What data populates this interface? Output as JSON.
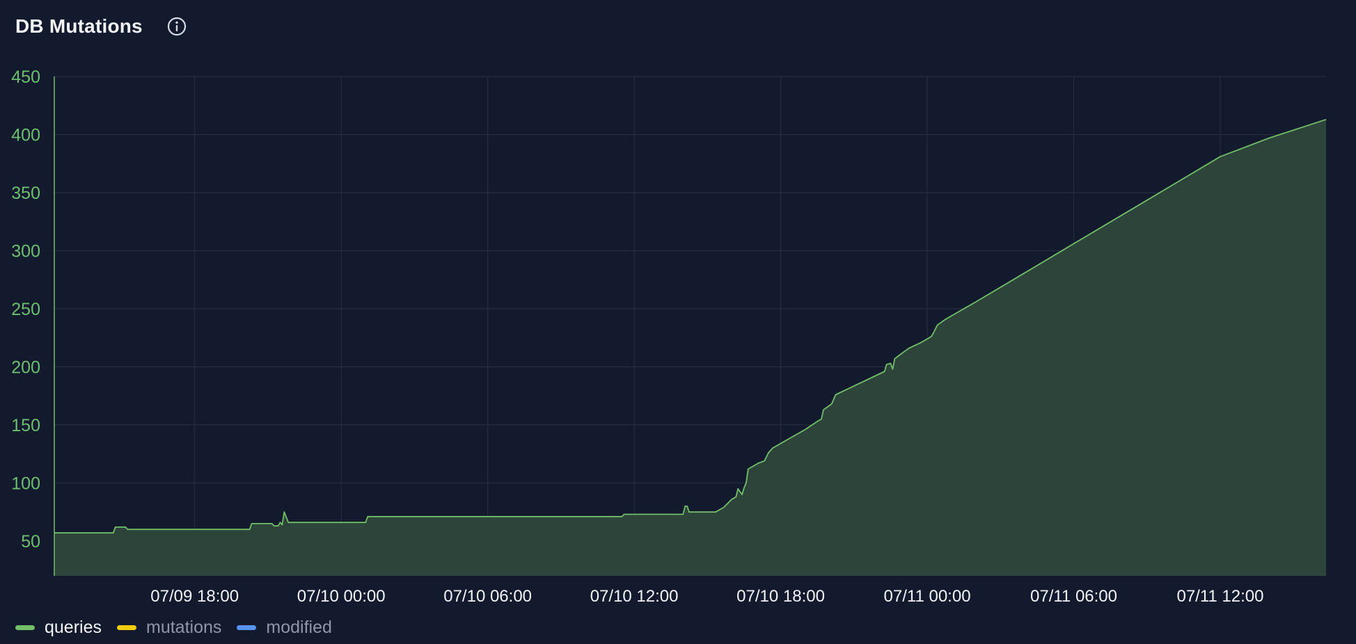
{
  "panel": {
    "title": "DB Mutations",
    "info_icon": "info-circle-icon"
  },
  "colors": {
    "background": "#131a2e",
    "grid": "#2a3146",
    "axis_text": "#6bbf6e",
    "x_tick_text": "#f2f4f8",
    "queries": "#73bf69",
    "queries_fill": "#2c4439",
    "mutations": "#f2cc0c",
    "modified": "#5794f2",
    "legend_active": "#f2f4f8",
    "legend_inactive": "#8e96a8"
  },
  "legend": [
    {
      "name": "queries",
      "color": "#73bf69",
      "active": true
    },
    {
      "name": "mutations",
      "color": "#f2cc0c",
      "active": false
    },
    {
      "name": "modified",
      "color": "#5794f2",
      "active": false
    }
  ],
  "chart_data": {
    "type": "area",
    "title": "DB Mutations",
    "xlabel": "",
    "ylabel": "",
    "x_unit": "hours",
    "xlim": [
      "07/09 12:15",
      "07/11 16:20"
    ],
    "ylim": [
      20,
      450
    ],
    "y_ticks": [
      50,
      100,
      150,
      200,
      250,
      300,
      350,
      400,
      450
    ],
    "x_ticks": [
      {
        "t": "07/09 18:00",
        "label": "07/09 18:00"
      },
      {
        "t": "07/10 00:00",
        "label": "07/10 00:00"
      },
      {
        "t": "07/10 06:00",
        "label": "07/10 06:00"
      },
      {
        "t": "07/10 12:00",
        "label": "07/10 12:00"
      },
      {
        "t": "07/10 18:00",
        "label": "07/10 18:00"
      },
      {
        "t": "07/11 00:00",
        "label": "07/11 00:00"
      },
      {
        "t": "07/11 06:00",
        "label": "07/11 06:00"
      },
      {
        "t": "07/11 12:00",
        "label": "07/11 12:00"
      }
    ],
    "grid": true,
    "legend_position": "bottom-left",
    "series": [
      {
        "name": "queries",
        "color": "#73bf69",
        "points": [
          [
            "07/09 12:15",
            57
          ],
          [
            "07/09 14:40",
            57
          ],
          [
            "07/09 14:45",
            62
          ],
          [
            "07/09 15:10",
            62
          ],
          [
            "07/09 15:15",
            60
          ],
          [
            "07/09 20:05",
            60
          ],
          [
            "07/09 20:15",
            60
          ],
          [
            "07/09 20:20",
            65
          ],
          [
            "07/09 21:10",
            65
          ],
          [
            "07/09 21:15",
            63
          ],
          [
            "07/09 21:25",
            63
          ],
          [
            "07/09 21:30",
            66
          ],
          [
            "07/09 21:35",
            64
          ],
          [
            "07/09 21:40",
            75
          ],
          [
            "07/09 21:50",
            66
          ],
          [
            "07/10 01:00",
            66
          ],
          [
            "07/10 01:05",
            71
          ],
          [
            "07/10 11:30",
            71
          ],
          [
            "07/10 11:35",
            73
          ],
          [
            "07/10 14:00",
            73
          ],
          [
            "07/10 14:05",
            80
          ],
          [
            "07/10 14:10",
            80
          ],
          [
            "07/10 14:15",
            75
          ],
          [
            "07/10 15:20",
            75
          ],
          [
            "07/10 15:40",
            79
          ],
          [
            "07/10 16:00",
            86
          ],
          [
            "07/10 16:10",
            88
          ],
          [
            "07/10 16:15",
            95
          ],
          [
            "07/10 16:25",
            90
          ],
          [
            "07/10 16:30",
            96
          ],
          [
            "07/10 16:35",
            100
          ],
          [
            "07/10 16:40",
            112
          ],
          [
            "07/10 16:50",
            114
          ],
          [
            "07/10 17:05",
            117
          ],
          [
            "07/10 17:20",
            119
          ],
          [
            "07/10 17:30",
            126
          ],
          [
            "07/10 17:40",
            130
          ],
          [
            "07/10 18:00",
            134
          ],
          [
            "07/10 18:30",
            140
          ],
          [
            "07/10 19:00",
            146
          ],
          [
            "07/10 19:30",
            153
          ],
          [
            "07/10 19:40",
            155
          ],
          [
            "07/10 19:45",
            163
          ],
          [
            "07/10 20:05",
            168
          ],
          [
            "07/10 20:15",
            176
          ],
          [
            "07/10 20:45",
            181
          ],
          [
            "07/10 21:15",
            186
          ],
          [
            "07/10 21:45",
            191
          ],
          [
            "07/10 22:15",
            196
          ],
          [
            "07/10 22:20",
            202
          ],
          [
            "07/10 22:30",
            203
          ],
          [
            "07/10 22:35",
            198
          ],
          [
            "07/10 22:40",
            207
          ],
          [
            "07/10 22:55",
            211
          ],
          [
            "07/10 23:15",
            216
          ],
          [
            "07/10 23:45",
            221
          ],
          [
            "07/11 00:10",
            226
          ],
          [
            "07/11 00:15",
            229
          ],
          [
            "07/11 00:25",
            236
          ],
          [
            "07/11 00:45",
            241
          ],
          [
            "07/11 02:00",
            256
          ],
          [
            "07/11 04:00",
            281
          ],
          [
            "07/11 06:00",
            306
          ],
          [
            "07/11 08:00",
            331
          ],
          [
            "07/11 10:00",
            356
          ],
          [
            "07/11 12:00",
            381
          ],
          [
            "07/11 14:00",
            397
          ],
          [
            "07/11 16:20",
            413
          ]
        ]
      },
      {
        "name": "mutations",
        "color": "#f2cc0c",
        "points": []
      },
      {
        "name": "modified",
        "color": "#5794f2",
        "points": []
      }
    ]
  }
}
